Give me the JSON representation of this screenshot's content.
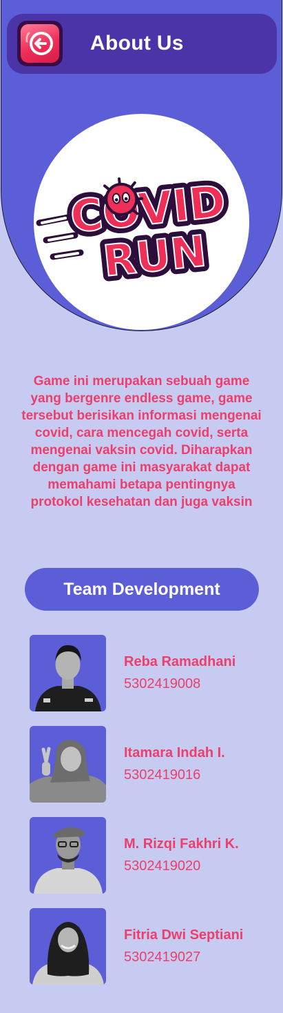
{
  "header": {
    "title": "About Us",
    "back_icon": "arrow-left-icon"
  },
  "logo": {
    "line1": "COVID",
    "line2": "RUN"
  },
  "description": "Game ini merupakan sebuah game yang bergenre endless game, game tersebut berisikan informasi mengenai covid, cara mencegah covid, serta mengenai vaksin covid. Diharapkan dengan game ini masyarakat dapat memahami betapa pentingnya protokol kesehatan dan juga vaksin",
  "team": {
    "title": "Team Development",
    "members": [
      {
        "name": "Reba Ramadhani",
        "id": "5302419008"
      },
      {
        "name": "Itamara Indah I.",
        "id": "5302419016"
      },
      {
        "name": "M. Rizqi Fakhri K.",
        "id": "5302419020"
      },
      {
        "name": "Fitria Dwi Septiani",
        "id": "5302419027"
      }
    ]
  },
  "colors": {
    "background": "#c7caf1",
    "primary": "#5b5ed6",
    "header": "#4b34a8",
    "accent": "#ec3f6b"
  }
}
